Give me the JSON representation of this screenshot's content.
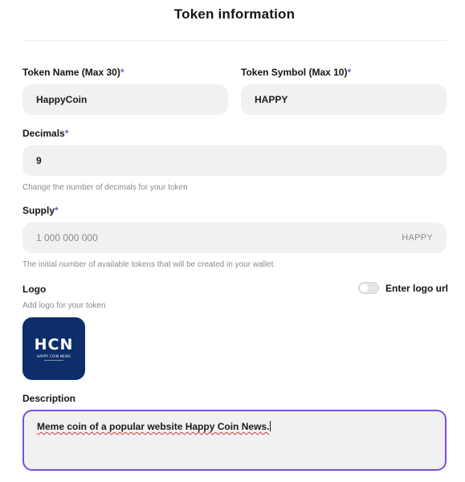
{
  "header": {
    "title": "Token information"
  },
  "token_name": {
    "label": "Token Name (Max 30)",
    "required_mark": "*",
    "value": "HappyCoin"
  },
  "token_symbol": {
    "label": "Token Symbol (Max 10)",
    "required_mark": "*",
    "value": "HAPPY"
  },
  "decimals": {
    "label": "Decimals",
    "required_mark": "*",
    "value": "9",
    "hint": "Change the number of decimals for your token"
  },
  "supply": {
    "label": "Supply",
    "required_mark": "*",
    "value": "1 000 000 000",
    "suffix": "HAPPY",
    "hint": "The initial number of available tokens that will be created in your wallet"
  },
  "logo": {
    "label": "Logo",
    "hint": "Add logo for your token",
    "toggle_label": "Enter logo url",
    "toggle_on": false,
    "image_text": "HCN",
    "image_subtext": "HAPPY COIN NEWS",
    "image_bg": "#0d2d6b"
  },
  "description": {
    "label": "Description",
    "value": "Meme coin of a popular website Happy Coin News."
  },
  "colors": {
    "accent": "#7a50d9",
    "field_bg": "#f1f1f1",
    "hint_text": "#8b8b8b"
  }
}
